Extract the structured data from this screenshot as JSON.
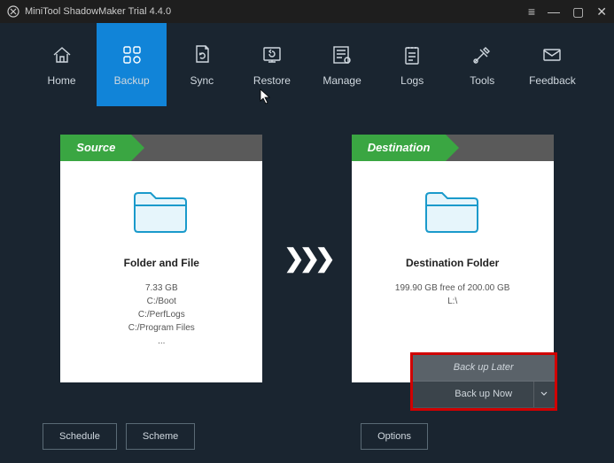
{
  "titlebar": {
    "title": "MiniTool ShadowMaker Trial 4.4.0"
  },
  "tabs": [
    {
      "label": "Home"
    },
    {
      "label": "Backup"
    },
    {
      "label": "Sync"
    },
    {
      "label": "Restore"
    },
    {
      "label": "Manage"
    },
    {
      "label": "Logs"
    },
    {
      "label": "Tools"
    },
    {
      "label": "Feedback"
    }
  ],
  "source": {
    "header": "Source",
    "title": "Folder and File",
    "size": "7.33 GB",
    "lines": [
      "C:/Boot",
      "C:/PerfLogs",
      "C:/Program Files",
      "..."
    ]
  },
  "destination": {
    "header": "Destination",
    "title": "Destination Folder",
    "size": "199.90 GB free of 200.00 GB",
    "drive": "L:\\"
  },
  "buttons": {
    "schedule": "Schedule",
    "scheme": "Scheme",
    "options": "Options",
    "backup_later": "Back up Later",
    "backup_now": "Back up Now"
  }
}
